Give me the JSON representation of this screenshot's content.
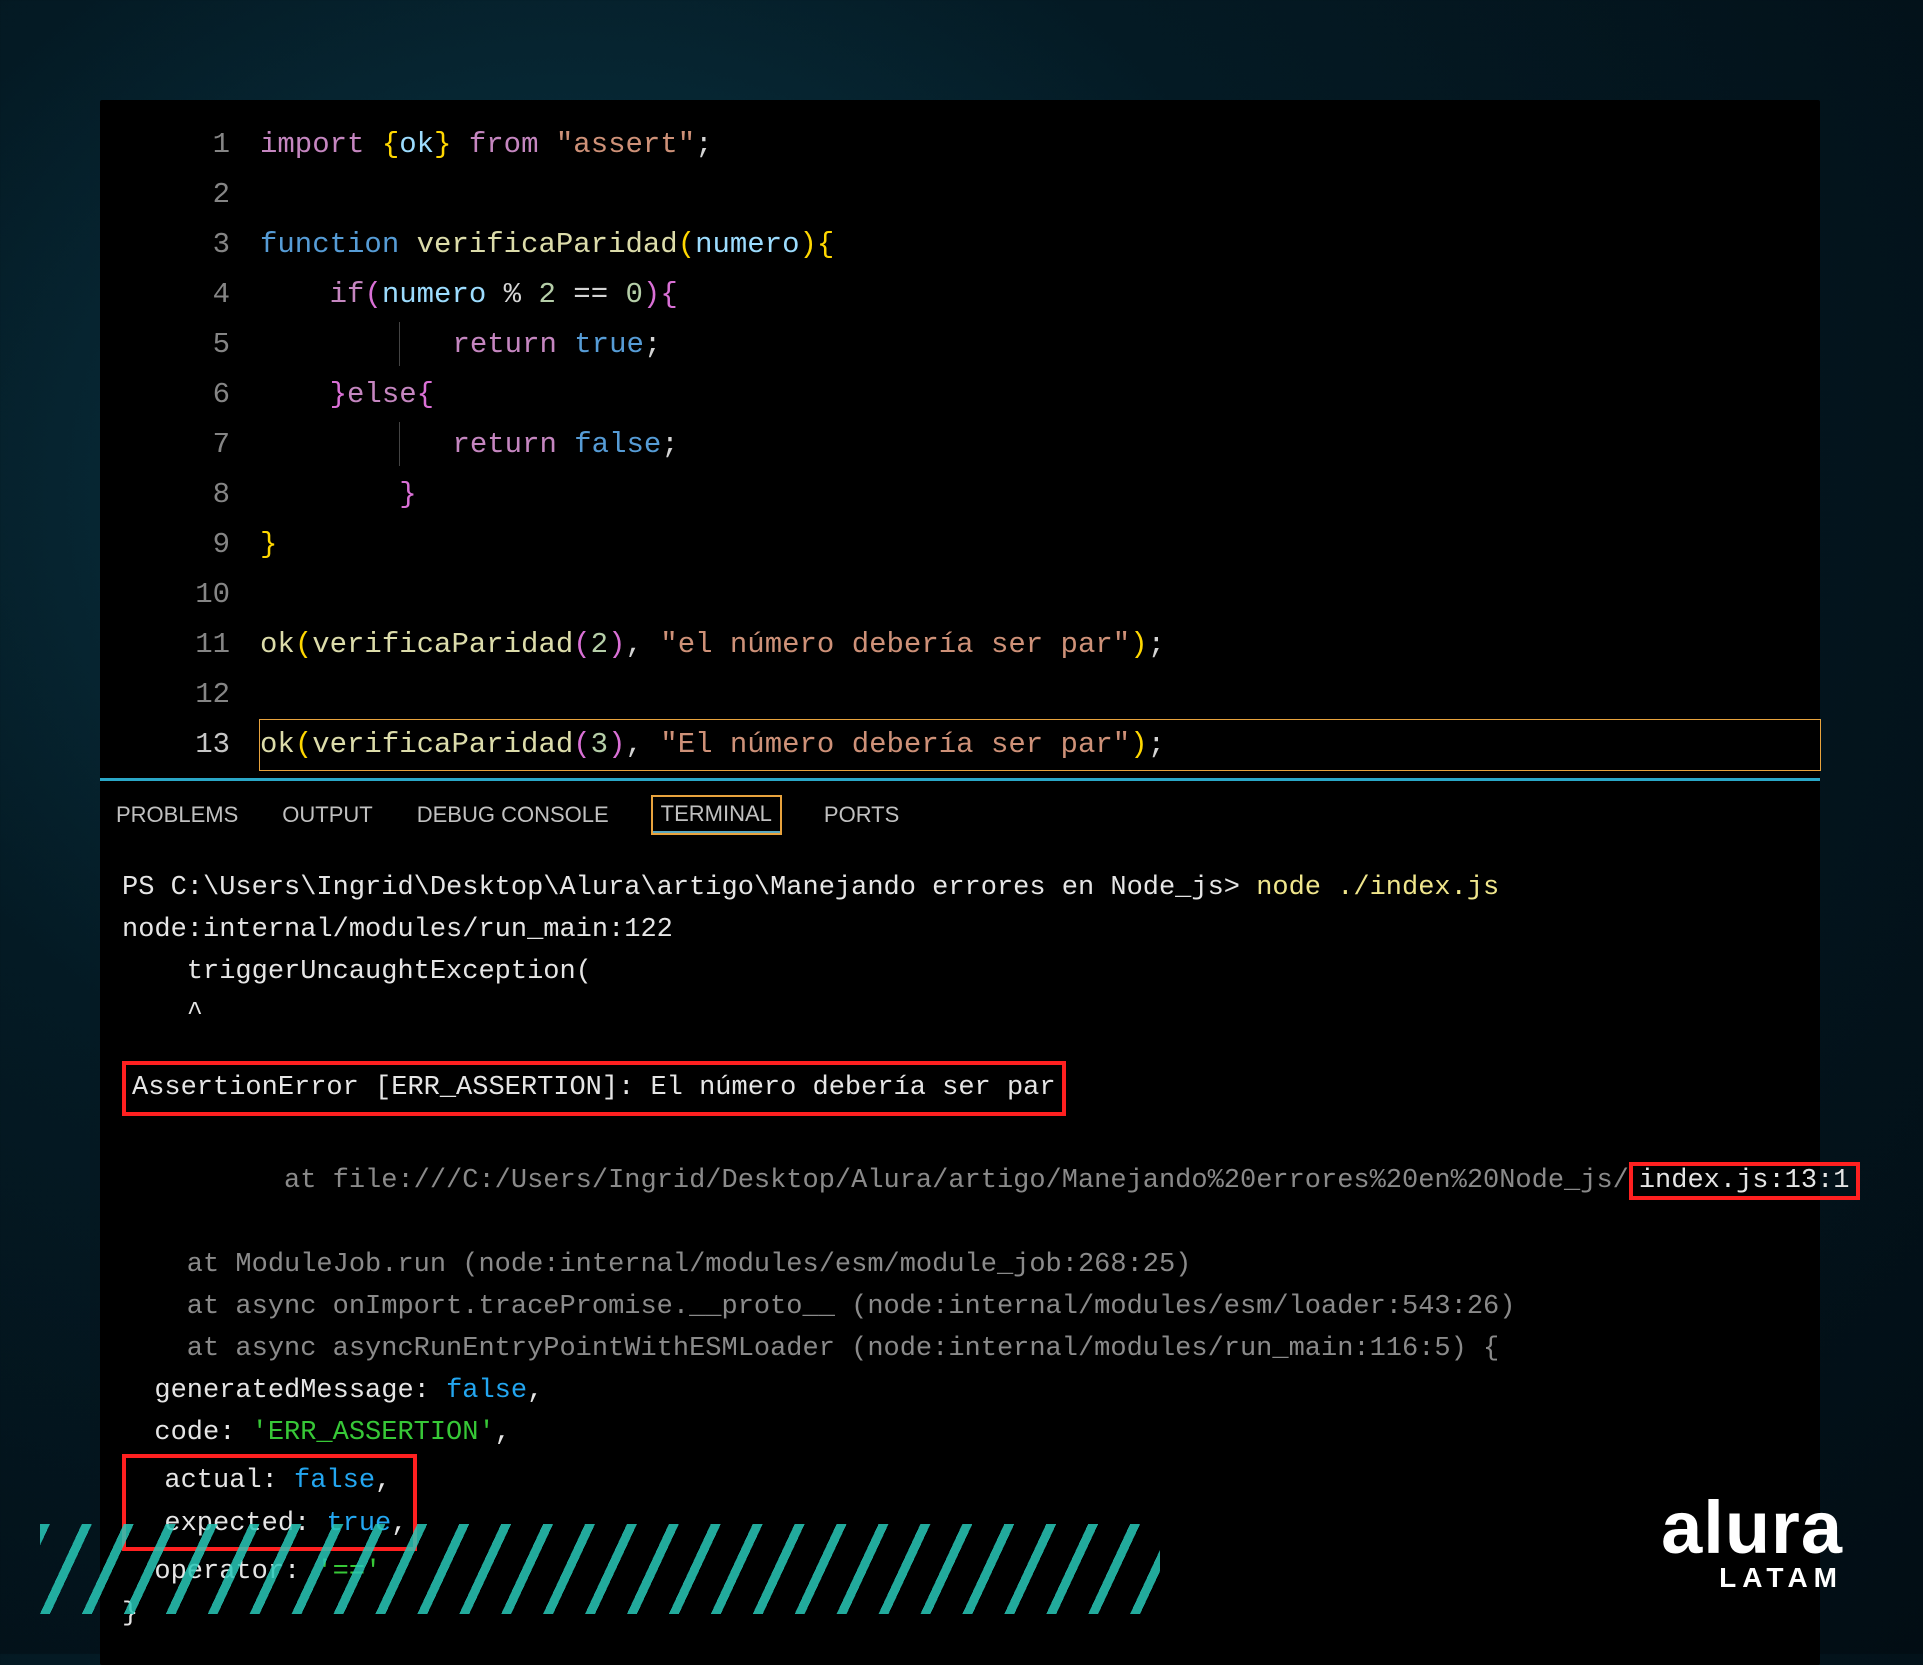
{
  "editor": {
    "lines": [
      {
        "n": "1",
        "html": "<span class='k-import'>import</span> <span class='brace'>{</span><span class='var'>ok</span><span class='brace'>}</span> <span class='k-from'>from</span> <span class='str'>\"assert\"</span>;"
      },
      {
        "n": "2",
        "html": ""
      },
      {
        "n": "3",
        "html": "<span class='k-func'>function</span> <span class='fn'>verificaParidad</span><span class='brace'>(</span><span class='var'>numero</span><span class='brace'>){</span>"
      },
      {
        "n": "4",
        "html": "    <span class='k-if'>if</span><span class='brace2'>(</span><span class='var'>numero</span> <span class='op'>%</span> <span class='numlit'>2</span> <span class='op'>==</span> <span class='numlit'>0</span><span class='brace2'>){</span>"
      },
      {
        "n": "5",
        "html": "        <span class='guide'></span>   <span class='k-return'>return</span> <span class='k-true'>true</span>;"
      },
      {
        "n": "6",
        "html": "    <span class='brace2'>}</span><span class='k-else'>else</span><span class='brace2'>{</span>"
      },
      {
        "n": "7",
        "html": "        <span class='guide'></span>   <span class='k-return'>return</span> <span class='k-false'>false</span>;"
      },
      {
        "n": "8",
        "html": "        <span class='brace2'>}</span>"
      },
      {
        "n": "9",
        "html": "<span class='brace'>}</span>"
      },
      {
        "n": "10",
        "html": ""
      },
      {
        "n": "11",
        "html": "<span class='fn'>ok</span><span class='brace'>(</span><span class='fn'>verificaParidad</span><span class='brace2'>(</span><span class='numlit'>2</span><span class='brace2'>)</span>, <span class='str'>\"el número debería ser par\"</span><span class='brace'>)</span>;"
      },
      {
        "n": "12",
        "html": ""
      },
      {
        "n": "13",
        "html": "<span class='fn'>ok</span><span class='brace'>(</span><span class='fn'>verificaParidad</span><span class='brace2'>(</span><span class='numlit'>3</span><span class='brace2'>)</span>, <span class='str'>\"El número debería ser par\"</span><span class='brace'>)</span>;",
        "current": true
      }
    ]
  },
  "tabs": {
    "problems": "PROBLEMS",
    "output": "OUTPUT",
    "debug": "DEBUG CONSOLE",
    "terminal": "TERMINAL",
    "ports": "PORTS"
  },
  "terminal": {
    "prompt_path": "PS C:\\Users\\Ingrid\\Desktop\\Alura\\artigo\\Manejando errores en Node_js>",
    "prompt_cmd": "node ./index.js",
    "line2": "node:internal/modules/run_main:122",
    "line3": "    triggerUncaughtException(",
    "line4": "    ^",
    "assertion": "AssertionError [ERR_ASSERTION]: El número debería ser par",
    "stack1_pre": "    at file:///C:/Users/Ingrid/Desktop/Alura/artigo/Manejando%20errores%20en%20Node_js/",
    "stack1_file": "index.js:13:1",
    "stack2": "    at ModuleJob.run (node:internal/modules/esm/module_job:268:25)",
    "stack3": "    at async onImport.tracePromise.__proto__ (node:internal/modules/esm/loader:543:26)",
    "stack4": "    at async asyncRunEntryPointWithESMLoader (node:internal/modules/run_main:116:5) {",
    "gen": "  generatedMessage: ",
    "gen_v": "false",
    "gen_c": ",",
    "code": "  code: ",
    "code_v": "'ERR_ASSERTION'",
    "code_c": ",",
    "actual_l": "  actual: ",
    "actual_v": "false",
    "actual_c": ",",
    "expected_l": "  expected: ",
    "expected_v": "true",
    "expected_c": ",",
    "op_l": "  operator: ",
    "op_v": "'=='",
    "close": "}"
  },
  "logo": {
    "brand": "alura",
    "sub": "LATAM"
  }
}
